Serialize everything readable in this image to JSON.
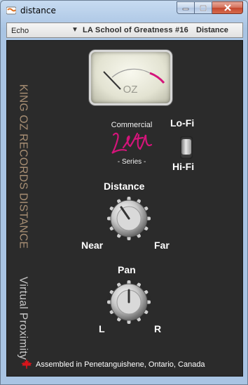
{
  "window": {
    "title": "distance"
  },
  "header": {
    "effect_type": "Echo",
    "preset_name": "LA School of Greatness #16",
    "plugin_name": "Distance"
  },
  "plugin": {
    "vertical_title": "KING OZ RECORDS DISTANCE",
    "vertical_subtitle": "Virtual Proximity",
    "meter_label": "OZ",
    "commercial_label": "Commercial",
    "series_label": "- Series -",
    "lofi_label": "Lo-Fi",
    "hifi_label": "Hi-Fi",
    "toggle_position": "hi-fi",
    "distance_label": "Distance",
    "distance_min_label": "Near",
    "distance_max_label": "Far",
    "pan_label": "Pan",
    "pan_left_label": "L",
    "pan_right_label": "R",
    "footer_text": "Assembled in Penetanguishene, Ontario, Canada"
  },
  "colors": {
    "panel_bg": "#2b2b2b",
    "accent_pink": "#d4147a",
    "vertical_title": "#a88f74",
    "leaf_red": "#d8141b"
  },
  "icons": [
    "app-icon",
    "minimize-icon",
    "maximize-icon",
    "close-icon",
    "dropdown-arrow-icon",
    "maple-leaf-icon"
  ]
}
